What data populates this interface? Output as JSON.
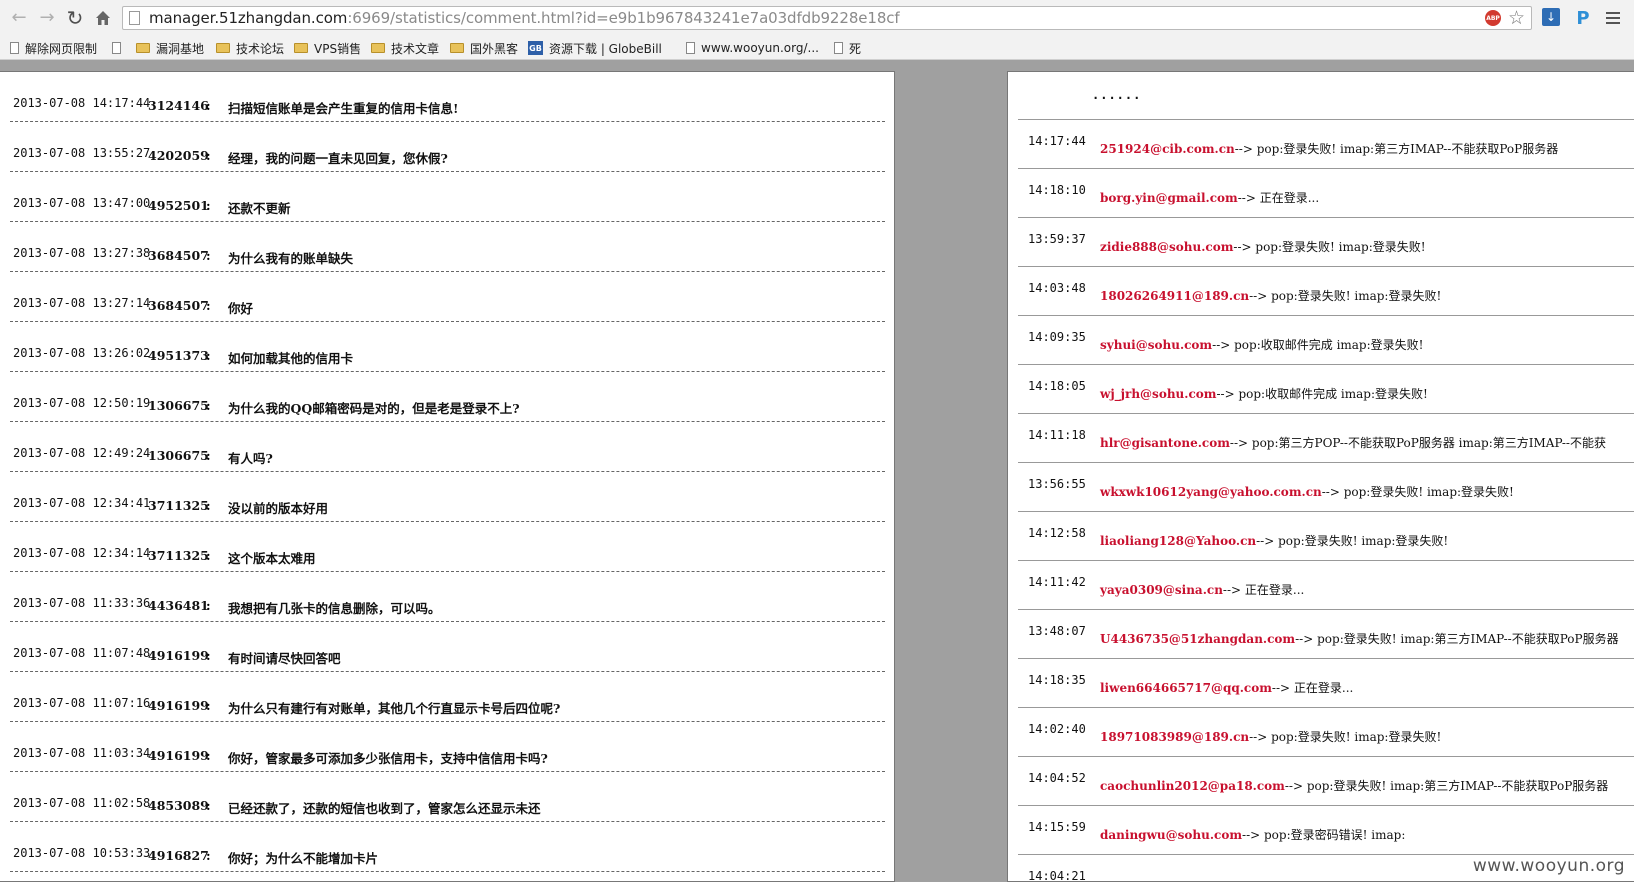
{
  "browser": {
    "url_host": "manager.51zhangdan.com",
    "url_rest": ":6969/statistics/comment.html?id=e9b1b967843241e7a03dfdb9228e18cf",
    "abp_label": "ABP",
    "ext_p_label": "P"
  },
  "bookmarks": [
    {
      "label": "解除网页限制",
      "icon": "page-icon"
    },
    {
      "label": "",
      "icon": "page-icon"
    },
    {
      "label": "漏洞基地",
      "icon": "folder-icon"
    },
    {
      "label": "技术论坛",
      "icon": "folder-icon"
    },
    {
      "label": "VPS销售",
      "icon": "folder-icon"
    },
    {
      "label": "技术文章",
      "icon": "folder-icon"
    },
    {
      "label": "国外黑客",
      "icon": "folder-icon"
    },
    {
      "label": "资源下载 | GlobeBill",
      "icon": "gb-icon"
    },
    {
      "label": "www.wooyun.org/...",
      "icon": "page-icon"
    },
    {
      "label": "死",
      "icon": "page-icon"
    }
  ],
  "comments": [
    {
      "time": "2013-07-08 14:17:44",
      "uid": "3124146",
      "text": "扫描短信账单是会产生重复的信用卡信息!"
    },
    {
      "time": "2013-07-08 13:55:27",
      "uid": "4202059",
      "text": "经理，我的问题一直未见回复，您休假?"
    },
    {
      "time": "2013-07-08 13:47:00",
      "uid": "4952501",
      "text": "还款不更新"
    },
    {
      "time": "2013-07-08 13:27:38",
      "uid": "3684507",
      "text": "为什么我有的账单缺失"
    },
    {
      "time": "2013-07-08 13:27:14",
      "uid": "3684507",
      "text": "你好"
    },
    {
      "time": "2013-07-08 13:26:02",
      "uid": "4951373",
      "text": "如何加载其他的信用卡"
    },
    {
      "time": "2013-07-08 12:50:19",
      "uid": "1306675",
      "text": "为什么我的QQ邮箱密码是对的，但是老是登录不上?"
    },
    {
      "time": "2013-07-08 12:49:24",
      "uid": "1306675",
      "text": "有人吗?"
    },
    {
      "time": "2013-07-08 12:34:41",
      "uid": "3711325",
      "text": "没以前的版本好用"
    },
    {
      "time": "2013-07-08 12:34:14",
      "uid": "3711325",
      "text": "这个版本太难用"
    },
    {
      "time": "2013-07-08 11:33:36",
      "uid": "4436481",
      "text": "我想把有几张卡的信息删除，可以吗。"
    },
    {
      "time": "2013-07-08 11:07:48",
      "uid": "4916199",
      "text": "有时间请尽快回答吧"
    },
    {
      "time": "2013-07-08 11:07:16",
      "uid": "4916199",
      "text": "为什么只有建行有对账单，其他几个行直显示卡号后四位呢?"
    },
    {
      "time": "2013-07-08 11:03:34",
      "uid": "4916199",
      "text": "你好，管家最多可添加多少张信用卡，支持中信信用卡吗?"
    },
    {
      "time": "2013-07-08 11:02:58",
      "uid": "4853089",
      "text": "已经还款了，还款的短信也收到了，管家怎么还显示未还"
    },
    {
      "time": "2013-07-08 10:53:33",
      "uid": "4916827",
      "text": "你好；为什么不能增加卡片"
    }
  ],
  "login_header": "......",
  "logins": [
    {
      "time": "14:17:44",
      "email": "251924@cib.com.cn",
      "status": "--> pop:登录失败! imap:第三方IMAP--不能获取PoP服务器"
    },
    {
      "time": "14:18:10",
      "email": "borg.yin@gmail.com",
      "status": "--> 正在登录..."
    },
    {
      "time": "13:59:37",
      "email": "zidie888@sohu.com",
      "status": "--> pop:登录失败! imap:登录失败!"
    },
    {
      "time": "14:03:48",
      "email": "18026264911@189.cn",
      "status": "--> pop:登录失败! imap:登录失败!"
    },
    {
      "time": "14:09:35",
      "email": "syhui@sohu.com",
      "status": "--> pop:收取邮件完成 imap:登录失败!"
    },
    {
      "time": "14:18:05",
      "email": "wj_jrh@sohu.com",
      "status": "--> pop:收取邮件完成 imap:登录失败!"
    },
    {
      "time": "14:11:18",
      "email": "hlr@gisantone.com",
      "status": "--> pop:第三方POP--不能获取PoP服务器 imap:第三方IMAP--不能获"
    },
    {
      "time": "13:56:55",
      "email": "wkxwk10612yang@yahoo.com.cn",
      "status": "--> pop:登录失败! imap:登录失败!"
    },
    {
      "time": "14:12:58",
      "email": "liaoliang128@Yahoo.cn",
      "status": "--> pop:登录失败! imap:登录失败!"
    },
    {
      "time": "14:11:42",
      "email": "yaya0309@sina.cn",
      "status": "--> 正在登录..."
    },
    {
      "time": "13:48:07",
      "email": "U4436735@51zhangdan.com",
      "status": "--> pop:登录失败! imap:第三方IMAP--不能获取PoP服务器"
    },
    {
      "time": "14:18:35",
      "email": "liwen664665717@qq.com",
      "status": "--> 正在登录..."
    },
    {
      "time": "14:02:40",
      "email": "18971083989@189.cn",
      "status": "--> pop:登录失败! imap:登录失败!"
    },
    {
      "time": "14:04:52",
      "email": "caochunlin2012@pa18.com",
      "status": "--> pop:登录失败! imap:第三方IMAP--不能获取PoP服务器"
    },
    {
      "time": "14:15:59",
      "email": "daningwu@sohu.com",
      "status": "--> pop:登录密码错误! imap:"
    },
    {
      "time": "14:04:21",
      "email": "",
      "status": ""
    }
  ],
  "watermark": "www.wooyun.org"
}
